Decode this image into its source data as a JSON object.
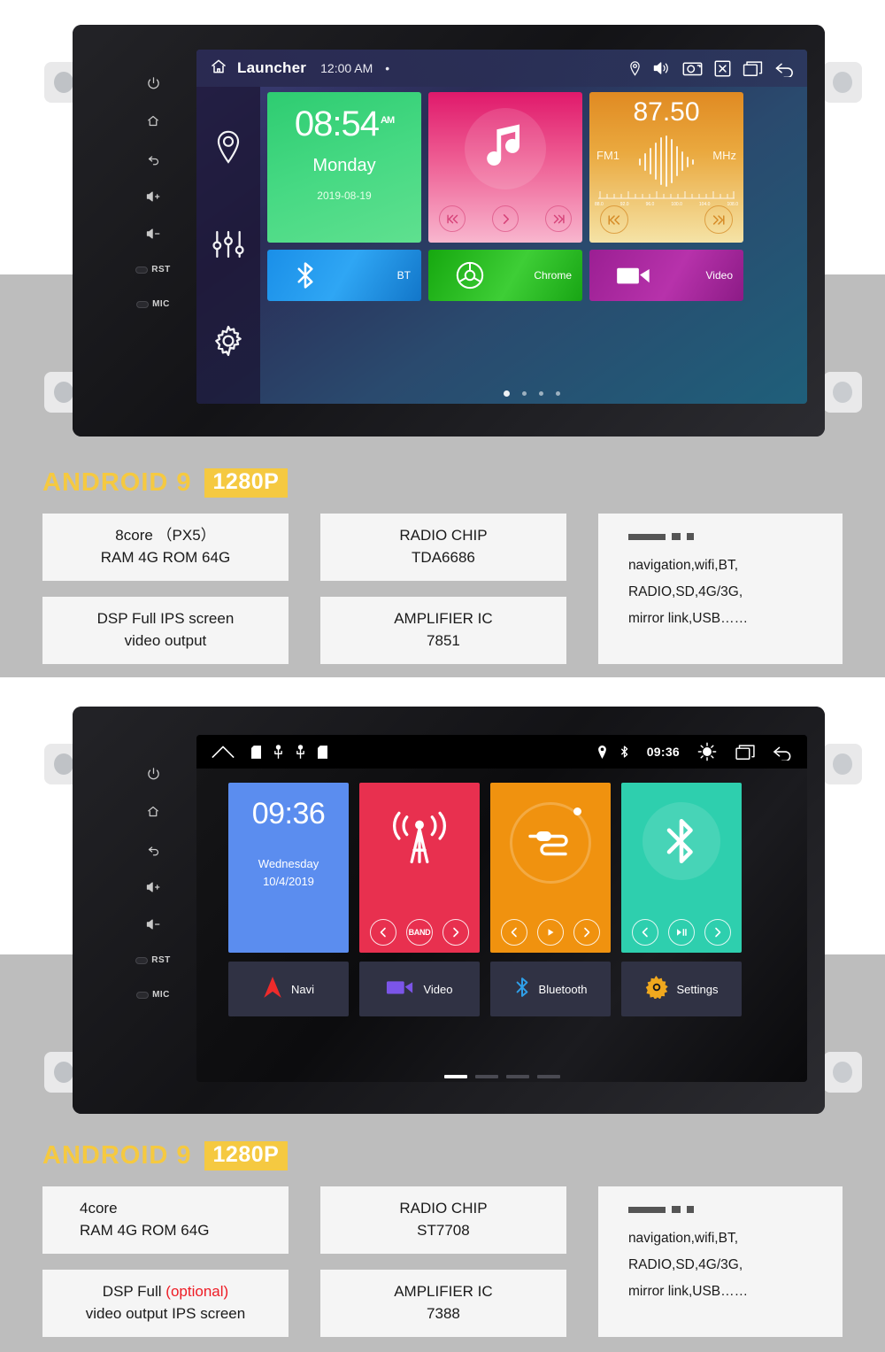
{
  "sections": [
    {
      "device": {
        "hardware_keys": [
          "power-icon",
          "home-icon",
          "back-icon",
          "volume-up-icon",
          "volume-down-icon"
        ],
        "hardware_labels": [
          "RST",
          "MIC"
        ],
        "status_bar": {
          "home_icon": "home-icon",
          "title": "Launcher",
          "time": "12:00 AM",
          "dot": "•",
          "icons": [
            "location-icon",
            "volume-icon",
            "camera-icon",
            "close-icon",
            "recents-icon",
            "back-icon"
          ]
        },
        "sidebar_icons": [
          "location-pin-icon",
          "equalizer-icon",
          "settings-gear-icon"
        ],
        "tiles": {
          "clock": {
            "time": "08:54",
            "meridiem": "AM",
            "day": "Monday",
            "date": "2019-08-19"
          },
          "music": {
            "icon": "music-note-icon",
            "controls": [
              "prev-icon",
              "play-icon",
              "next-icon"
            ]
          },
          "radio": {
            "frequency": "87.50",
            "band": "FM1",
            "unit": "MHz",
            "scale_labels": [
              "88.0",
              "92.0",
              "96.0",
              "100.0",
              "104.0",
              "108.0"
            ],
            "controls": [
              "prev-icon",
              "next-icon"
            ]
          },
          "shortcuts": [
            {
              "label": "BT",
              "icon": "bluetooth-icon"
            },
            {
              "label": "Chrome",
              "icon": "chrome-icon"
            },
            {
              "label": "Video",
              "icon": "video-camera-icon"
            }
          ]
        },
        "page_dots": 4,
        "active_dot": 0
      },
      "specs": {
        "android": "ANDROID 9",
        "resolution": "1280P",
        "cpu_line1": "8core （PX5）",
        "cpu_line2": "RAM 4G ROM 64G",
        "dsp_line1": "DSP Full IPS screen",
        "dsp_line1_optional": "",
        "dsp_line2": "video output",
        "radio_chip_title": "RADIO CHIP",
        "radio_chip_value": "TDA6686",
        "amp_title": "AMPLIFIER IC",
        "amp_value": "7851",
        "features": [
          "navigation,wifi,BT,",
          "RADIO,SD,4G/3G,",
          "mirror link,USB……"
        ]
      }
    },
    {
      "device": {
        "hardware_keys": [
          "power-icon",
          "home-icon",
          "back-icon",
          "volume-up-icon",
          "volume-down-icon"
        ],
        "hardware_labels": [
          "RST",
          "MIC"
        ],
        "status_bar": {
          "left_icons": [
            "home-icon",
            "sd-card-icon",
            "usb-icon",
            "usb-icon",
            "sd-card-icon"
          ],
          "right_icons": [
            "location-icon",
            "bluetooth-icon"
          ],
          "time": "09:36",
          "trailing_icons": [
            "brightness-icon",
            "recents-icon",
            "back-icon"
          ]
        },
        "tiles": {
          "clock": {
            "time": "09:36",
            "day": "Wednesday",
            "date": "10/4/2019"
          },
          "radio": {
            "icon": "radio-tower-icon",
            "controls": [
              "prev-icon",
              "BAND",
              "next-icon"
            ]
          },
          "usb": {
            "icon": "usb-plug-icon",
            "controls": [
              "prev-icon",
              "play-icon",
              "next-icon"
            ]
          },
          "bluetooth": {
            "icon": "bluetooth-icon",
            "controls": [
              "prev-icon",
              "play-pause-icon",
              "next-icon"
            ]
          },
          "shortcuts": [
            {
              "label": "Navi",
              "icon": "navigation-arrow-icon"
            },
            {
              "label": "Video",
              "icon": "video-camera-icon"
            },
            {
              "label": "Bluetooth",
              "icon": "bluetooth-icon"
            },
            {
              "label": "Settings",
              "icon": "settings-gear-icon"
            }
          ]
        },
        "page_dashes": 4,
        "active_dash": 0
      },
      "specs": {
        "android": "ANDROID 9",
        "resolution": "1280P",
        "cpu_line1": "4core",
        "cpu_line2": "RAM 4G ROM 64G",
        "dsp_line1": "DSP Full ",
        "dsp_line1_optional": "(optional)",
        "dsp_line2": "video output IPS screen",
        "radio_chip_title": "RADIO CHIP",
        "radio_chip_value": "ST7708",
        "amp_title": "AMPLIFIER IC",
        "amp_value": "7388",
        "features": [
          "navigation,wifi,BT,",
          "RADIO,SD,4G/3G,",
          "mirror link,USB……"
        ]
      }
    }
  ],
  "colors": {
    "accent_yellow": "#f5c941",
    "optional_red": "#ee1c25",
    "page_gray": "#bdbdbd",
    "card_bg": "#f5f5f5"
  }
}
